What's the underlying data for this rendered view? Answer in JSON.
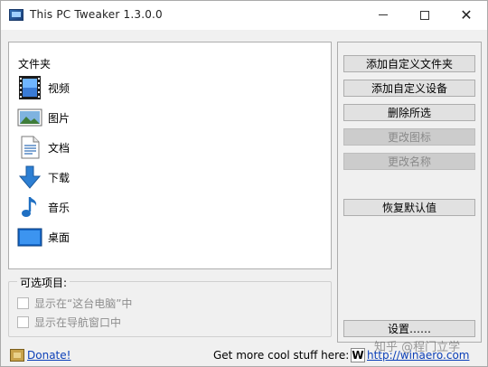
{
  "window": {
    "title": "This PC Tweaker 1.3.0.0",
    "controls": {
      "minimize": "minimize",
      "maximize": "maximize",
      "close": "✕"
    }
  },
  "folders": {
    "group_label": "文件夹",
    "items": [
      {
        "label": "视频",
        "icon": "video-folder-icon"
      },
      {
        "label": "图片",
        "icon": "pictures-folder-icon"
      },
      {
        "label": "文档",
        "icon": "documents-folder-icon"
      },
      {
        "label": "下载",
        "icon": "downloads-folder-icon"
      },
      {
        "label": "音乐",
        "icon": "music-folder-icon"
      },
      {
        "label": "桌面",
        "icon": "desktop-folder-icon"
      }
    ]
  },
  "options": {
    "title": "可选项目:",
    "items": [
      {
        "label": "显示在“这台电脑”中",
        "checked": false,
        "enabled": false
      },
      {
        "label": "显示在导航窗口中",
        "checked": false,
        "enabled": false
      }
    ]
  },
  "buttons": {
    "add_custom_folder": "添加自定义文件夹",
    "add_custom_device": "添加自定义设备",
    "remove_selected": "删除所选",
    "change_icon": "更改图标",
    "change_name": "更改名称",
    "restore_defaults": "恢复默认值",
    "settings": "设置……"
  },
  "footer": {
    "donate": "Donate!",
    "more_text": "Get more cool stuff here:",
    "site_icon": "W",
    "site_link": "http://winaero.com"
  },
  "watermark": "知乎 @程门立学",
  "colors": {
    "link": "#0b3fb8",
    "disabled_text": "#8a8a8a",
    "window_bg": "#f0f0f0"
  }
}
